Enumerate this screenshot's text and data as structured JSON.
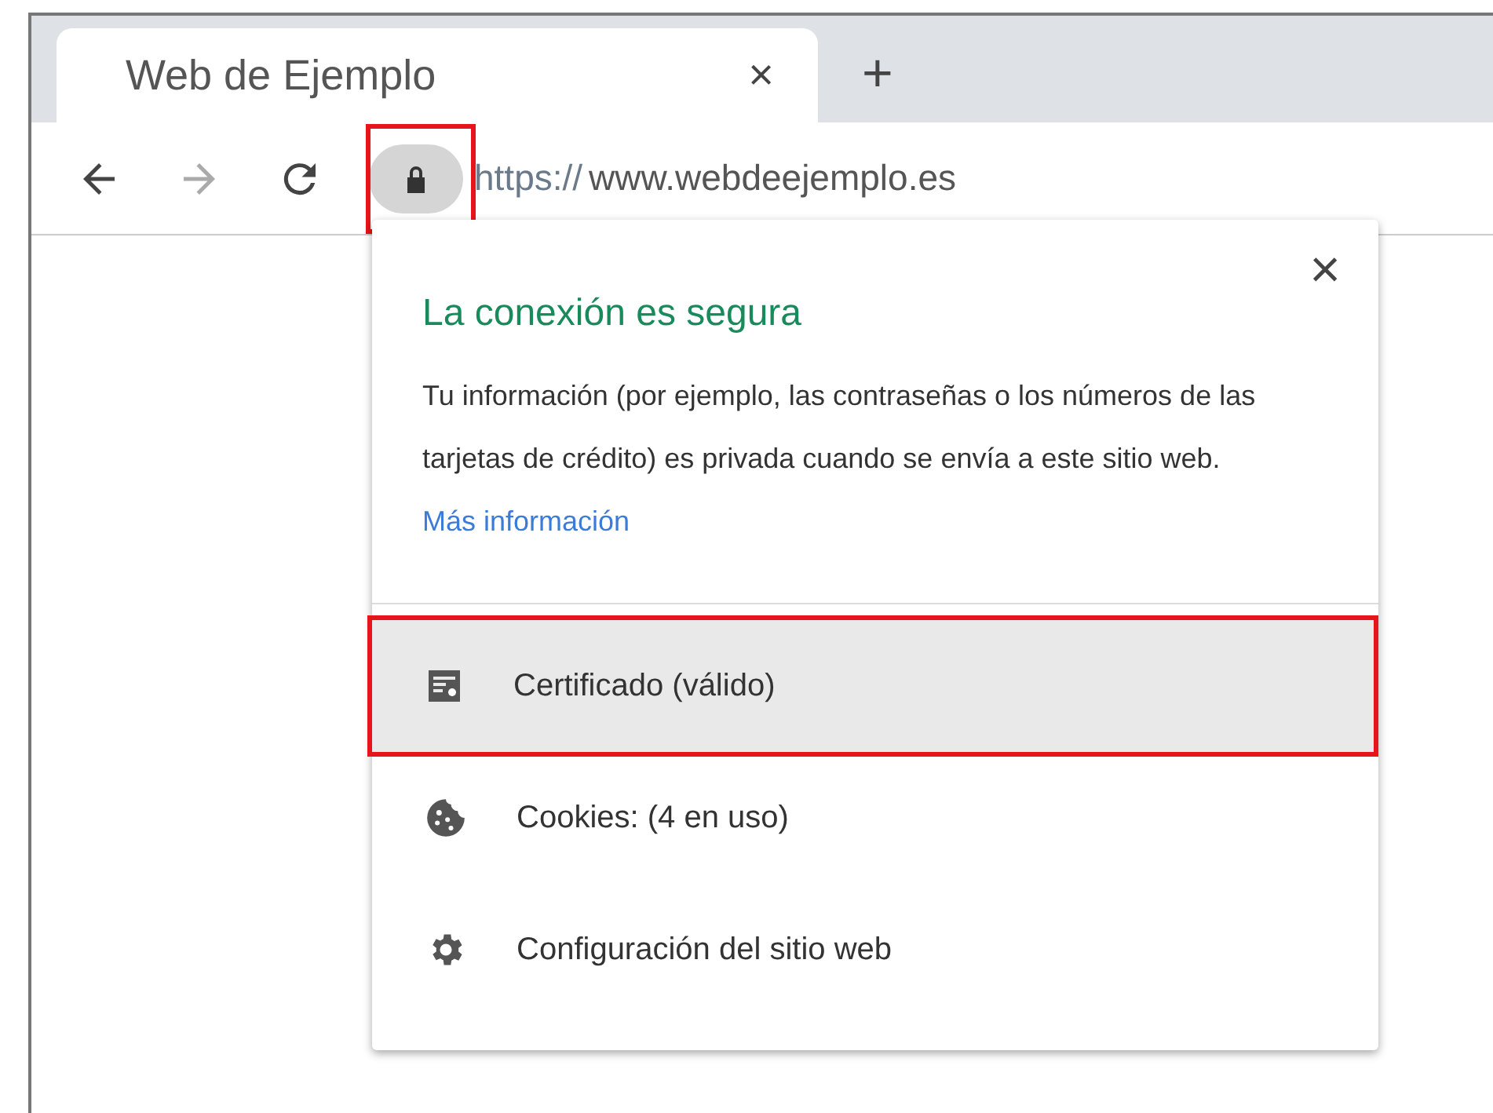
{
  "tab": {
    "title": "Web de Ejemplo",
    "close": "×",
    "new_tab": "+"
  },
  "toolbar": {
    "lock_highlighted": true,
    "url_scheme": "https://",
    "url_host": "www.webdeejemplo.es"
  },
  "popup": {
    "close": "×",
    "title": "La conexión es segura",
    "body": "Tu información (por ejemplo, las contraseñas o los números de las tarjetas de crédito) es privada cuando se envía a este sitio web.",
    "link": "Más información",
    "items": [
      {
        "kind": "certificate",
        "label": "Certificado (válido)",
        "selected": true,
        "highlighted": true
      },
      {
        "kind": "cookies",
        "label": "Cookies: (4 en uso)",
        "selected": false,
        "highlighted": false
      },
      {
        "kind": "settings",
        "label": "Configuración del sitio web",
        "selected": false,
        "highlighted": false
      }
    ]
  }
}
